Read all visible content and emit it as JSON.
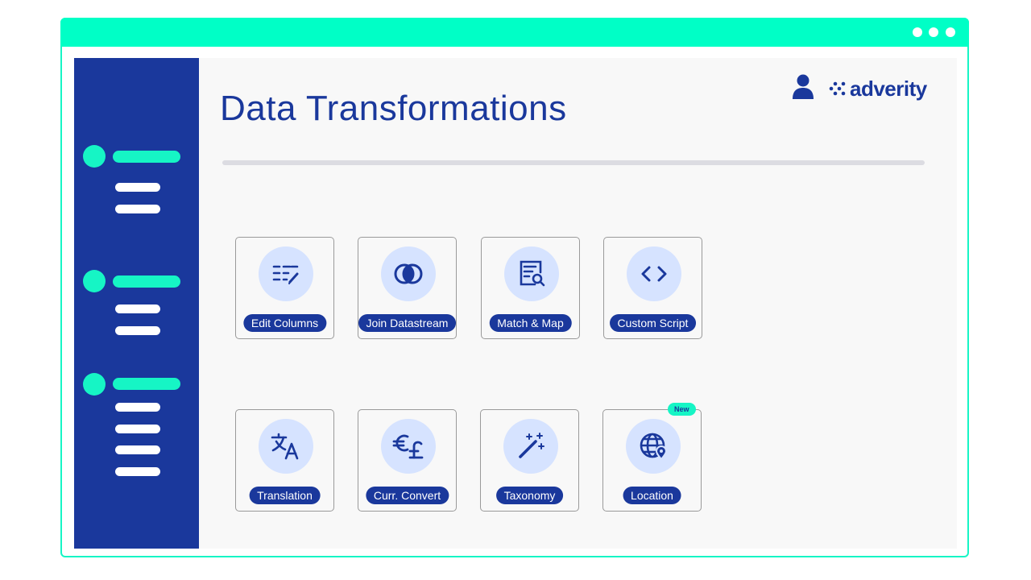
{
  "window": {
    "controls": [
      "dot",
      "dot",
      "dot"
    ]
  },
  "header": {
    "title": "Data Transformations",
    "logo_text": "adverity",
    "user_icon": "user-icon",
    "logo_icon": "adverity-logo-icon"
  },
  "colors": {
    "brand_navy": "#1a389c",
    "accent_mint": "#16f5c5",
    "icon_circle": "#d6e3ff"
  },
  "tools": [
    {
      "label": "Edit Columns",
      "icon": "edit-columns-icon"
    },
    {
      "label": "Join Datastream",
      "icon": "join-datastream-icon"
    },
    {
      "label": "Match & Map",
      "icon": "match-map-icon"
    },
    {
      "label": "Custom Script",
      "icon": "code-icon"
    },
    {
      "label": "Translation",
      "icon": "translate-icon"
    },
    {
      "label": "Curr. Convert",
      "icon": "currency-icon"
    },
    {
      "label": "Taxonomy",
      "icon": "magic-wand-icon"
    },
    {
      "label": "Location",
      "icon": "globe-pin-icon",
      "badge": "New"
    }
  ]
}
